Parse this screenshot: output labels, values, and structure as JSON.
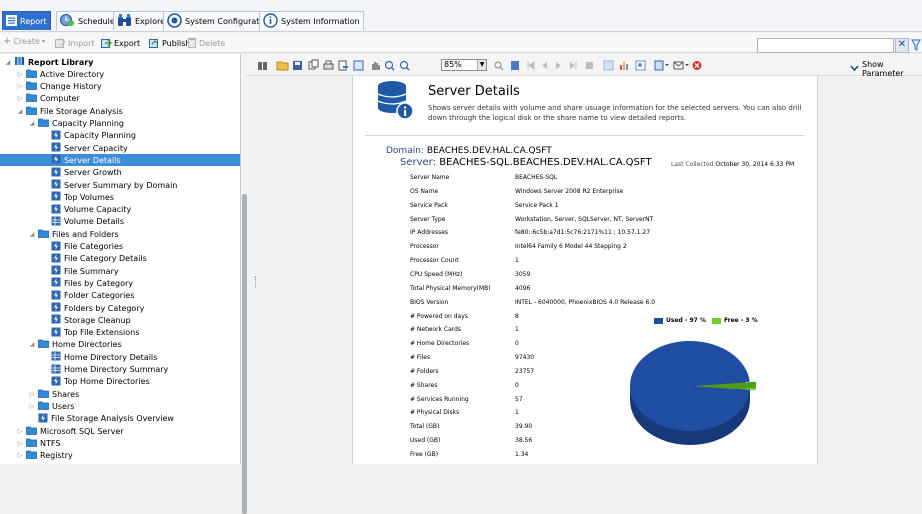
{
  "nav_tabs": [
    {
      "label": "Report",
      "icon": "list-icon"
    },
    {
      "label": "Schedule",
      "icon": "schedule-icon"
    },
    {
      "label": "Explore",
      "icon": "binoculars-icon"
    },
    {
      "label": "System Configuration",
      "icon": "gear-icon"
    },
    {
      "label": "System Information",
      "icon": "info-icon"
    }
  ],
  "commands": [
    {
      "label": "Create",
      "suffix": "▾",
      "disabled": true
    },
    {
      "label": "Import",
      "disabled": true
    },
    {
      "label": "Export",
      "disabled": false
    },
    {
      "label": "Publish",
      "disabled": false
    },
    {
      "label": "Delete",
      "disabled": true
    }
  ],
  "search": {
    "value": "",
    "clear": "✕"
  },
  "tree": [
    {
      "label": "Report Library",
      "level": 0,
      "icon": "library",
      "bold": true,
      "expanded": true
    },
    {
      "label": "Active Directory",
      "level": 1,
      "icon": "folder"
    },
    {
      "label": "Change History",
      "level": 1,
      "icon": "folder"
    },
    {
      "label": "Computer",
      "level": 1,
      "icon": "folder"
    },
    {
      "label": "File Storage Analysis",
      "level": 1,
      "icon": "folder",
      "expanded": true
    },
    {
      "label": "Capacity Planning",
      "level": 2,
      "icon": "folder",
      "expanded": true
    },
    {
      "label": "Capacity Planning",
      "level": 3,
      "icon": "report"
    },
    {
      "label": "Server Capacity",
      "level": 3,
      "icon": "report"
    },
    {
      "label": "Server Details",
      "level": 3,
      "icon": "report",
      "selected": true
    },
    {
      "label": "Server Growth",
      "level": 3,
      "icon": "report"
    },
    {
      "label": "Server Summary by Domain",
      "level": 3,
      "icon": "report"
    },
    {
      "label": "Top Volumes",
      "level": 3,
      "icon": "report"
    },
    {
      "label": "Volume Capacity",
      "level": 3,
      "icon": "report"
    },
    {
      "label": "Volume Details",
      "level": 3,
      "icon": "grid"
    },
    {
      "label": "Files and Folders",
      "level": 2,
      "icon": "folder",
      "expanded": true
    },
    {
      "label": "File Categories",
      "level": 3,
      "icon": "report"
    },
    {
      "label": "File Category Details",
      "level": 3,
      "icon": "report"
    },
    {
      "label": "File Summary",
      "level": 3,
      "icon": "report"
    },
    {
      "label": "Files by Category",
      "level": 3,
      "icon": "report"
    },
    {
      "label": "Folder Categories",
      "level": 3,
      "icon": "report"
    },
    {
      "label": "Folders by Category",
      "level": 3,
      "icon": "report"
    },
    {
      "label": "Storage Cleanup",
      "level": 3,
      "icon": "report"
    },
    {
      "label": "Top File Extensions",
      "level": 3,
      "icon": "report"
    },
    {
      "label": "Home Directories",
      "level": 2,
      "icon": "folder",
      "expanded": true
    },
    {
      "label": "Home Directory Details",
      "level": 3,
      "icon": "grid"
    },
    {
      "label": "Home Directory Summary",
      "level": 3,
      "icon": "grid"
    },
    {
      "label": "Top Home Directories",
      "level": 3,
      "icon": "report"
    },
    {
      "label": "Shares",
      "level": 2,
      "icon": "folder"
    },
    {
      "label": "Users",
      "level": 2,
      "icon": "folder"
    },
    {
      "label": "File Storage Analysis Overview",
      "level": 2,
      "icon": "report"
    },
    {
      "label": "Microsoft SQL Server",
      "level": 1,
      "icon": "folder"
    },
    {
      "label": "NTFS",
      "level": 1,
      "icon": "folder"
    },
    {
      "label": "Registry",
      "level": 1,
      "icon": "folder"
    }
  ],
  "viewer": {
    "zoom": "85%",
    "show_parameters": "Show Parameter"
  },
  "report": {
    "title": "Server Details",
    "description": "Shows server details with volume and share usuage information for the selected servers. You can also drill down through the logical disk or the share name to view detailed reports.",
    "domain_label": "Domain:",
    "domain_value": "BEACHES.DEV.HAL.CA.QSFT",
    "server_label": "Server:",
    "server_value": "BEACHES-SQL.BEACHES.DEV.HAL.CA.QSFT",
    "last_collected_label": "Last Collected:",
    "last_collected_value": "October 30, 2014 6:33 PM",
    "fields": [
      {
        "label": "Server Name",
        "value": "BEACHES-SQL"
      },
      {
        "label": "OS Name",
        "value": "Windows Server 2008 R2 Enterprise"
      },
      {
        "label": "Service Pack",
        "value": "Service Pack 1"
      },
      {
        "label": "Server Type",
        "value": "Workstation, Server, SQLServer, NT, ServerNT"
      },
      {
        "label": "IP Addresses",
        "value": "fe80::6c5b:a7d1:5c76:2171%11 ; 10.57.1.27"
      },
      {
        "label": "Processor",
        "value": "Intel64 Family 6 Model 44 Stepping 2"
      },
      {
        "label": "Processor Count",
        "value": "1"
      },
      {
        "label": "CPU Speed (MHz)",
        "value": "3059"
      },
      {
        "label": "Total Physical Memory(MB)",
        "value": "4096"
      },
      {
        "label": "BIOS Version",
        "value": "INTEL - 6040000, PhoenixBIOS 4.0 Release 6.0"
      },
      {
        "label": "# Powered on days",
        "value": "8"
      },
      {
        "label": "# Network Cards",
        "value": "1"
      },
      {
        "label": "# Home Directories",
        "value": "0"
      },
      {
        "label": "# Files",
        "value": "97430"
      },
      {
        "label": "# Folders",
        "value": "23757"
      },
      {
        "label": "# Shares",
        "value": "0"
      },
      {
        "label": "# Services Running",
        "value": "57"
      },
      {
        "label": "# Physical Disks",
        "value": "1"
      },
      {
        "label": "Total (GB)",
        "value": "39.90"
      },
      {
        "label": "Used (GB)",
        "value": "38.56"
      },
      {
        "label": "Free (GB)",
        "value": "1.34"
      }
    ],
    "legend": [
      {
        "label": "Used - 97 %",
        "color": "#1f4ea3"
      },
      {
        "label": "Free - 3 %",
        "color": "#6fcf2f"
      }
    ]
  },
  "chart_data": {
    "type": "pie",
    "categories": [
      "Used",
      "Free"
    ],
    "values": [
      97,
      3
    ],
    "title": ""
  }
}
